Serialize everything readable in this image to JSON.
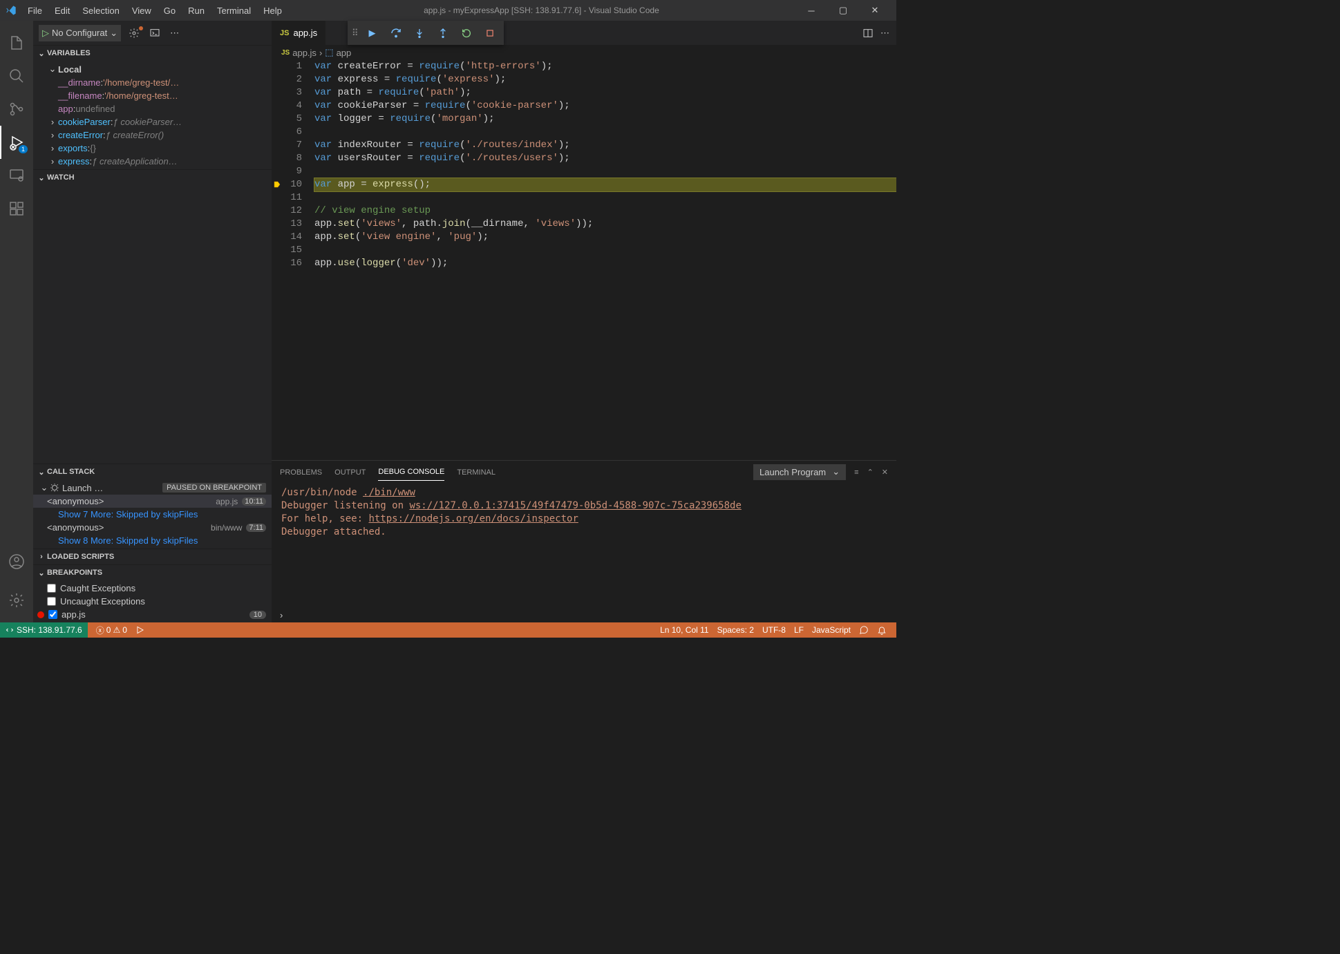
{
  "window": {
    "title": "app.js - myExpressApp [SSH: 138.91.77.6] - Visual Studio Code"
  },
  "menubar": [
    "File",
    "Edit",
    "Selection",
    "View",
    "Go",
    "Run",
    "Terminal",
    "Help"
  ],
  "activitybar": {
    "debug_badge": "1"
  },
  "debug": {
    "config_name": "No Configurat",
    "float_buttons": [
      "continue",
      "step-over",
      "step-into",
      "step-out",
      "restart",
      "stop"
    ]
  },
  "sections": {
    "variables": {
      "title": "Variables",
      "scope": "Local",
      "items": [
        {
          "name": "__dirname",
          "value": "'/home/greg-test/…",
          "kind": "str"
        },
        {
          "name": "__filename",
          "value": "'/home/greg-test…",
          "kind": "str"
        },
        {
          "name": "app",
          "value": "undefined",
          "kind": "undef"
        },
        {
          "name": "cookieParser",
          "value": "ƒ cookieParser…",
          "kind": "func",
          "exp": true
        },
        {
          "name": "createError",
          "value": "ƒ createError()",
          "kind": "func",
          "exp": true
        },
        {
          "name": "exports",
          "value": "{}",
          "kind": "obj",
          "exp": true
        },
        {
          "name": "express",
          "value": "ƒ createApplication…",
          "kind": "func",
          "exp": true
        }
      ]
    },
    "watch": {
      "title": "Watch"
    },
    "callstack": {
      "title": "Call Stack",
      "thread": "Launch …",
      "state": "PAUSED ON BREAKPOINT",
      "frames": [
        {
          "name": "<anonymous>",
          "file": "app.js",
          "loc": "10:11",
          "selected": true
        },
        {
          "more": "Show 7 More: Skipped by skipFiles"
        },
        {
          "name": "<anonymous>",
          "file": "bin/www",
          "loc": "7:11"
        },
        {
          "more": "Show 8 More: Skipped by skipFiles"
        }
      ]
    },
    "loaded_scripts": {
      "title": "Loaded Scripts"
    },
    "breakpoints": {
      "title": "Breakpoints",
      "items": [
        {
          "label": "Caught Exceptions",
          "checked": false
        },
        {
          "label": "Uncaught Exceptions",
          "checked": false
        },
        {
          "label": "app.js",
          "checked": true,
          "dot": true,
          "count": "10"
        }
      ]
    }
  },
  "editor": {
    "tab_file": "app.js",
    "breadcrumb": {
      "file": "app.js",
      "symbol": "app"
    },
    "current_line": 10,
    "lines": [
      "var createError = require('http-errors');",
      "var express = require('express');",
      "var path = require('path');",
      "var cookieParser = require('cookie-parser');",
      "var logger = require('morgan');",
      "",
      "var indexRouter = require('./routes/index');",
      "var usersRouter = require('./routes/users');",
      "",
      "var app = express();",
      "",
      "// view engine setup",
      "app.set('views', path.join(__dirname, 'views'));",
      "app.set('view engine', 'pug');",
      "",
      "app.use(logger('dev'));"
    ]
  },
  "panel": {
    "tabs": [
      "Problems",
      "Output",
      "Debug Console",
      "Terminal"
    ],
    "active_tab": "Debug Console",
    "selector": "Launch Program",
    "console": [
      {
        "pre": "/usr/bin/node ",
        "link": "./bin/www",
        "post": ""
      },
      {
        "pre": "Debugger listening on ",
        "link": "ws://127.0.0.1:37415/49f47479-0b5d-4588-907c-75ca239658de",
        "post": ""
      },
      {
        "pre": "For help, see: ",
        "link": "https://nodejs.org/en/docs/inspector",
        "post": ""
      },
      {
        "pre": "Debugger attached.",
        "link": "",
        "post": ""
      }
    ]
  },
  "statusbar": {
    "remote": "SSH: 138.91.77.6",
    "errors": "0",
    "warnings": "0",
    "position": "Ln 10, Col 11",
    "spaces": "Spaces: 2",
    "encoding": "UTF-8",
    "eol": "LF",
    "language": "JavaScript"
  }
}
